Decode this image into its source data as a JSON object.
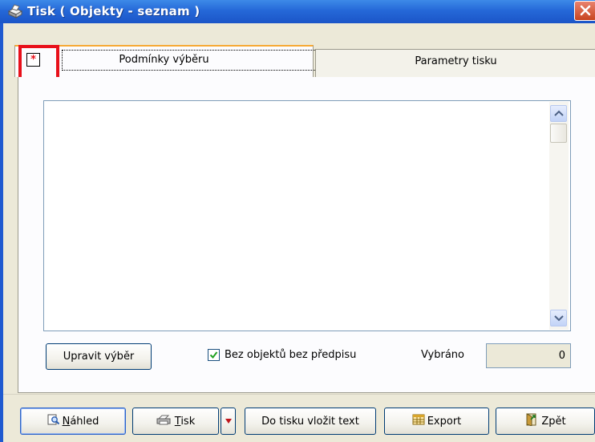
{
  "window": {
    "title": "Tisk ( Objekty - seznam )"
  },
  "tabs": [
    {
      "label": "Podmínky výběru",
      "active": true
    },
    {
      "label": "Parametry tisku",
      "active": false
    }
  ],
  "tab_marker_glyph": "*",
  "panel": {
    "edit_button": "Upravit výběr",
    "checkbox_label": "Bez objektů bez předpisu",
    "checkbox_checked": true,
    "selected_label": "Vybráno",
    "selected_value": "0"
  },
  "footer": {
    "preview_key": "N",
    "preview_rest": "áhled",
    "print_key": "T",
    "print_rest": "isk",
    "insert_text": "Do tisku vložit text",
    "export": "Export",
    "back": "Zpět"
  },
  "colors": {
    "titlebar": "#2568d8",
    "marker": "#e8101a",
    "window_bg": "#ece9d8",
    "active_tab_accent": "#f6a934"
  },
  "icons": [
    "printer-icon",
    "close-icon",
    "scroll-up-icon",
    "scroll-down-icon",
    "preview-icon",
    "print-icon",
    "dropdown-arrow-icon",
    "export-table-icon",
    "back-icon",
    "checkmark-icon"
  ]
}
